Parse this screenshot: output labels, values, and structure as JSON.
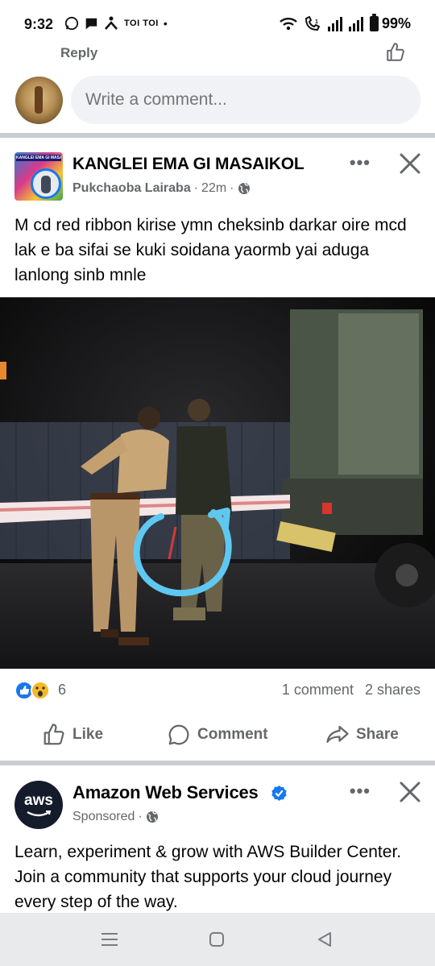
{
  "status_bar": {
    "time": "9:32",
    "carrier_text": "TOI TOI",
    "battery": "99%"
  },
  "reply_bar": {
    "reply_label": "Reply"
  },
  "comment_box": {
    "placeholder": "Write a comment..."
  },
  "post": {
    "page_name": "KANGLEI EMA GI MASAIKOL",
    "page_avatar_text": "KANGLEI EMA GI MASAIKOL",
    "author": "Pukchaoba Lairaba",
    "time": "22m",
    "text": "M cd red ribbon kirise ymn cheksinb darkar oire mcd lak e ba sifai se kuki soidana yaormb yai aduga lanlong  sinb mnle",
    "reaction_count": "6",
    "comments": "1 comment",
    "shares": "2 shares",
    "actions": {
      "like": "Like",
      "comment": "Comment",
      "share": "Share"
    }
  },
  "ad": {
    "name": "Amazon Web Services",
    "logo_text": "aws",
    "sponsored": "Sponsored",
    "text": "Learn, experiment & grow with AWS Builder Center. Join a community that supports your cloud journey every step of the way."
  },
  "colors": {
    "accent": "#1877f2",
    "secondary_text": "#65676b",
    "highlight_circle": "#5ec8f0",
    "reaction_love_wow": "#f7b928"
  }
}
